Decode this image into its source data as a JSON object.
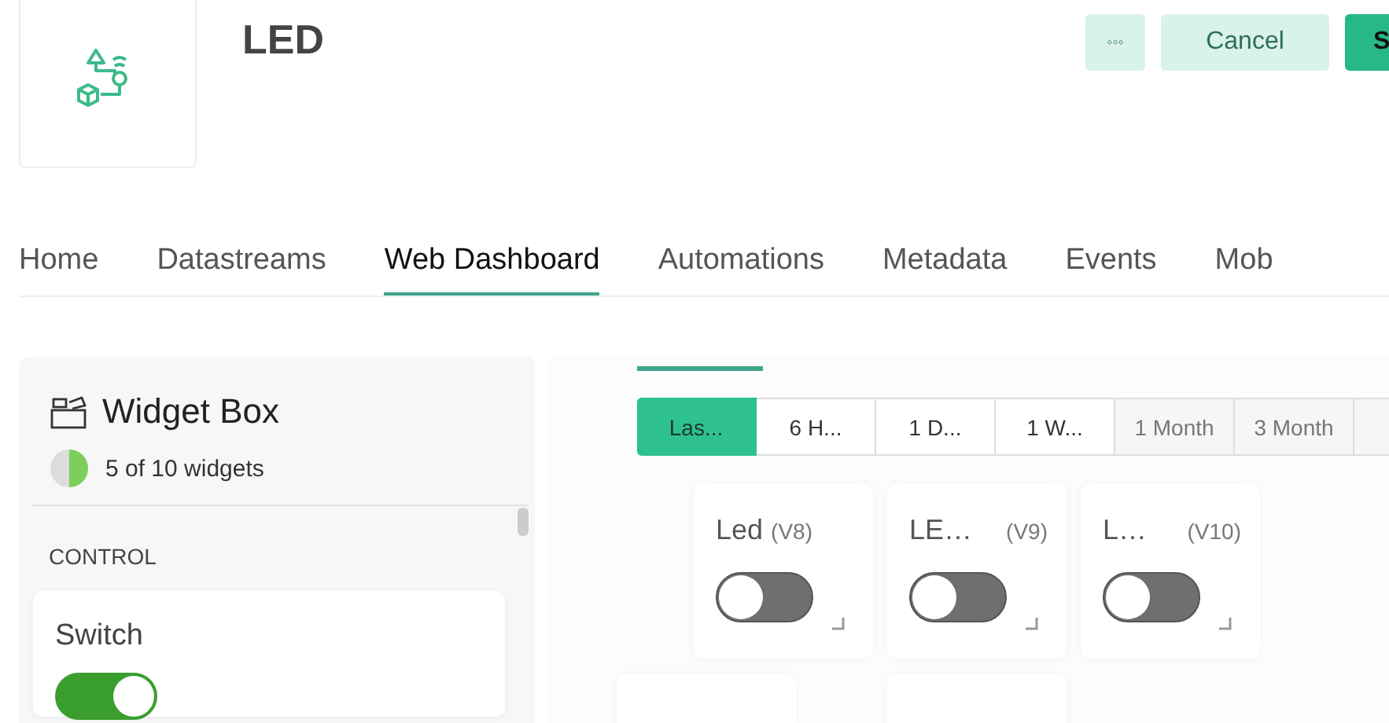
{
  "header": {
    "title": "LED",
    "actions": [
      {
        "kind": "more",
        "label": "◦◦◦"
      },
      {
        "kind": "secondary",
        "label": "Cancel"
      },
      {
        "kind": "primary",
        "label": "S"
      }
    ]
  },
  "tabs": [
    {
      "label": "Home",
      "selected": false
    },
    {
      "label": "Datastreams",
      "selected": false
    },
    {
      "label": "Web Dashboard",
      "selected": true
    },
    {
      "label": "Automations",
      "selected": false
    },
    {
      "label": "Metadata",
      "selected": false
    },
    {
      "label": "Events",
      "selected": false
    },
    {
      "label": "Mob",
      "selected": false
    }
  ],
  "widget_box": {
    "title": "Widget Box",
    "usage": "5 of 10 widgets",
    "level": 0.5,
    "section": "CONTROL",
    "widgets": [
      {
        "name": "Switch",
        "on": true
      }
    ]
  },
  "time_ranges": [
    {
      "label": "Las...",
      "selected": true
    },
    {
      "label": "6 H...",
      "selected": false
    },
    {
      "label": "1 D...",
      "selected": false
    },
    {
      "label": "1 W...",
      "selected": false
    },
    {
      "label": "1 Month",
      "selected": false
    },
    {
      "label": "3 Month",
      "selected": false
    },
    {
      "selected": false
    }
  ],
  "dashboard_widgets": [
    {
      "name": "Led",
      "pin": "(V8)",
      "on": false
    },
    {
      "name": "LE…",
      "pin": "(V9)",
      "on": false
    },
    {
      "name": "L…",
      "pin": "(V10)",
      "on": false
    }
  ]
}
